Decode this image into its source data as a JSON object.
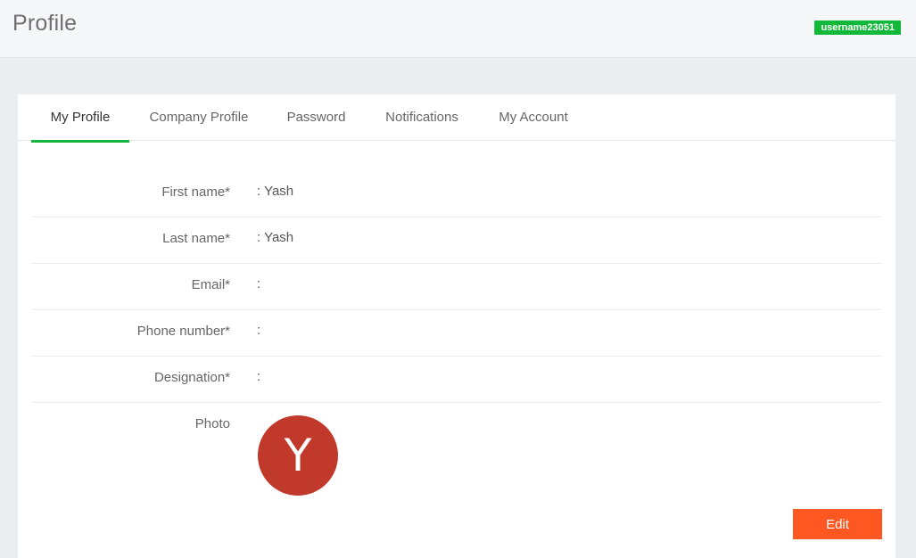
{
  "header": {
    "title": "Profile",
    "username_badge": "username23051"
  },
  "tabs": [
    {
      "label": "My Profile",
      "active": true
    },
    {
      "label": "Company Profile",
      "active": false
    },
    {
      "label": "Password",
      "active": false
    },
    {
      "label": "Notifications",
      "active": false
    },
    {
      "label": "My Account",
      "active": false
    }
  ],
  "profile": {
    "fields": [
      {
        "label": "First name*",
        "value": ": Yash"
      },
      {
        "label": "Last name*",
        "value": ": Yash"
      },
      {
        "label": "Email*",
        "value": ":"
      },
      {
        "label": "Phone number*",
        "value": ":"
      },
      {
        "label": "Designation*",
        "value": ":"
      }
    ],
    "photo_label": "Photo",
    "avatar_initial": "Y",
    "avatar_color": "#c0392b"
  },
  "actions": {
    "edit_label": "Edit"
  },
  "colors": {
    "accent_green": "#14b33b",
    "badge_green": "#12b83a",
    "edit_orange": "#ff5722"
  }
}
